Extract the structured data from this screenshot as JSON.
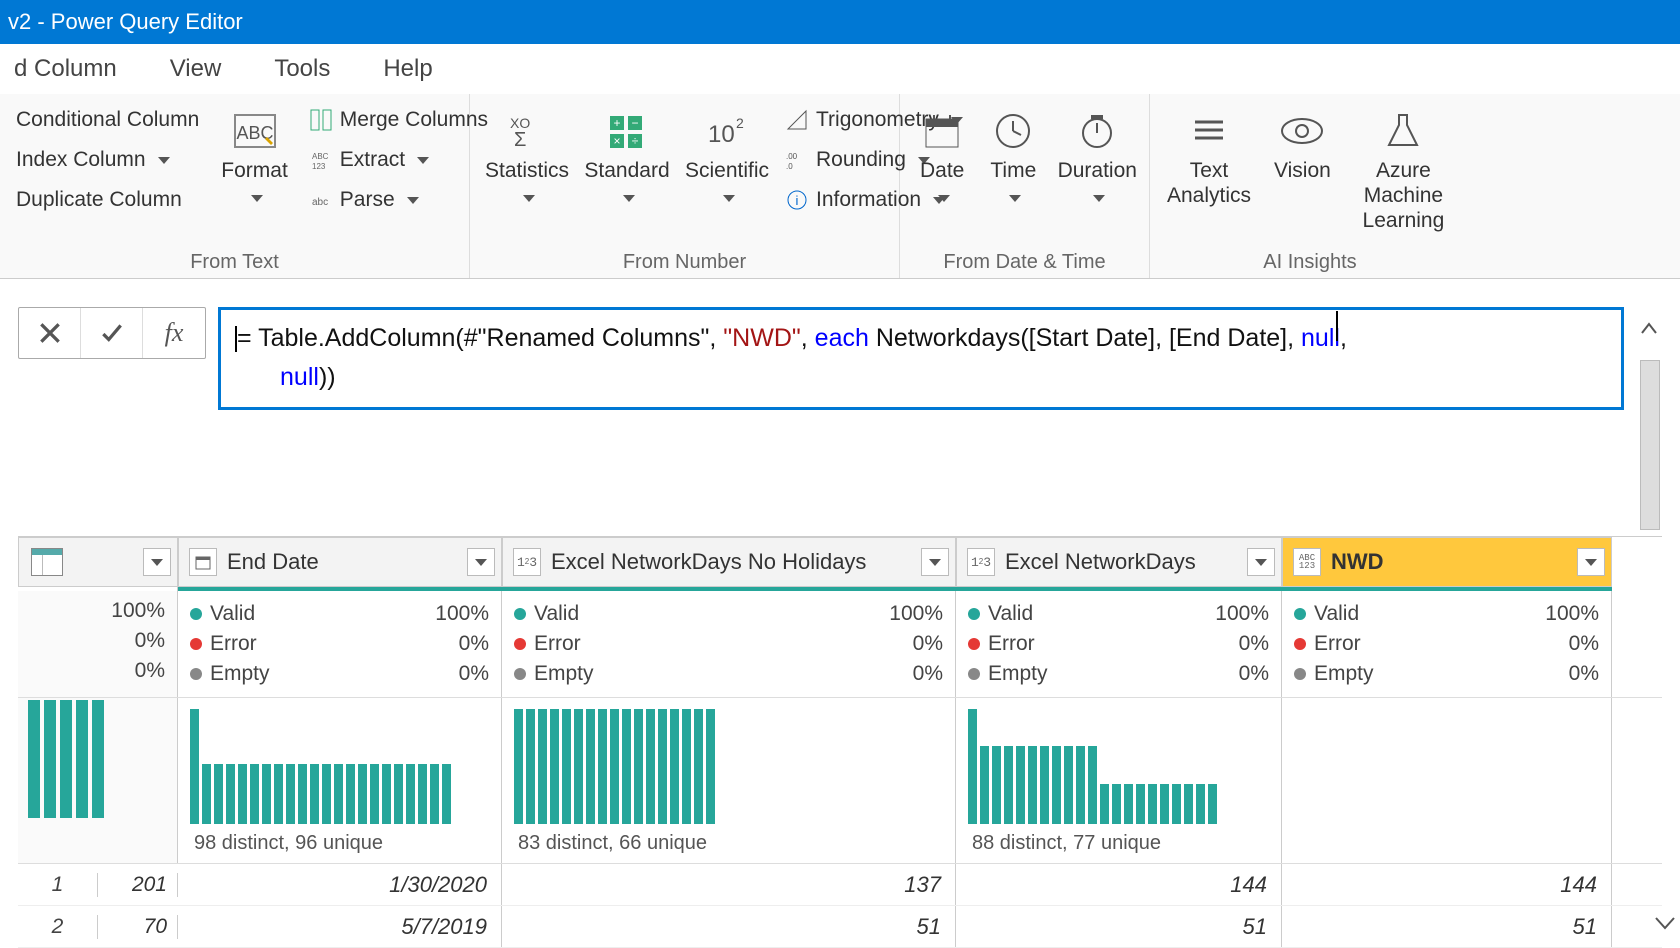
{
  "title": "v2 - Power Query Editor",
  "menu": {
    "add_column": "d Column",
    "view": "View",
    "tools": "Tools",
    "help": "Help"
  },
  "ribbon": {
    "col_ops": {
      "conditional": "Conditional Column",
      "index": "Index Column",
      "duplicate": "Duplicate Column"
    },
    "format": "Format",
    "text_ops": {
      "merge": "Merge Columns",
      "extract": "Extract",
      "parse": "Parse"
    },
    "group_text": "From Text",
    "number": {
      "statistics": "Statistics",
      "standard": "Standard",
      "scientific": "Scientific",
      "trig": "Trigonometry",
      "rounding": "Rounding",
      "info": "Information"
    },
    "group_number": "From Number",
    "datetime": {
      "date": "Date",
      "time": "Time",
      "duration": "Duration"
    },
    "group_datetime": "From Date & Time",
    "ai": {
      "text": "Text Analytics",
      "vision": "Vision",
      "aml": "Azure Machine Learning"
    },
    "group_ai": "AI Insights"
  },
  "formula": {
    "p1": "= Table.AddColumn(#\"Renamed Columns\", ",
    "str1": "\"NWD\"",
    "p2": ", ",
    "kw_each": "each",
    "p3": " Networkdays([Start Date], [End Da",
    "p3b": "te], ",
    "kw_null1": "null",
    "p4": ", ",
    "kw_null2": "null",
    "p5": "))"
  },
  "columns": {
    "c1": "End Date",
    "c2": "Excel NetworkDays No Holidays",
    "c3": "Excel NetworkDays",
    "c4": "NWD"
  },
  "quality": {
    "valid": "Valid",
    "error": "Error",
    "empty": "Empty",
    "left_100": "100%",
    "left_0": "0%",
    "pct_100": "100%",
    "pct_0": "0%"
  },
  "hist": {
    "c1": "98 distinct, 96 unique",
    "c2": "83 distinct, 66 unique",
    "c3": "88 distinct, 77 unique",
    "c4": ""
  },
  "rows": [
    {
      "idx": "1",
      "v0": "201",
      "v1": "1/30/2020",
      "v2": "137",
      "v3": "144",
      "v4": "144"
    },
    {
      "idx": "2",
      "v0": "70",
      "v1": "5/7/2019",
      "v2": "51",
      "v3": "51",
      "v4": "51"
    }
  ]
}
